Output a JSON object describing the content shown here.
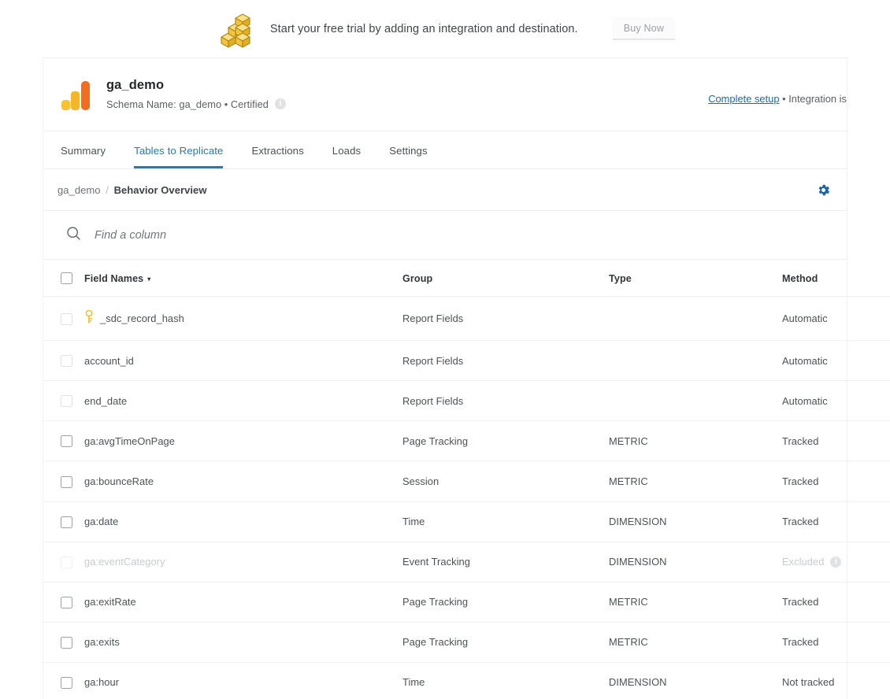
{
  "banner": {
    "icon": "stacked-blocks-icon",
    "text": "Start your free trial by adding an integration and destination.",
    "cta_label": "Buy Now"
  },
  "integration": {
    "logo": "google-analytics-logo",
    "name": "ga_demo",
    "subtitle": "Schema Name: ga_demo • Certified",
    "subtitle_info_icon": "info-icon",
    "status_link_label": "Complete setup",
    "status_text": "• Integration is",
    "link_color": "#176cb0"
  },
  "tabs": [
    {
      "label": "Summary",
      "active": false
    },
    {
      "label": "Tables to Replicate",
      "active": true
    },
    {
      "label": "Extractions",
      "active": false
    },
    {
      "label": "Loads",
      "active": false
    },
    {
      "label": "Settings",
      "active": false
    }
  ],
  "tab_active_color": "#2079c4",
  "breadcrumb": {
    "root": "ga_demo",
    "separator": "/",
    "current": "Behavior Overview",
    "settings_icon": "gear-icon",
    "settings_icon_color": "#1c63a8"
  },
  "search": {
    "icon": "search-icon",
    "placeholder": "Find a column",
    "value": ""
  },
  "table": {
    "columns": [
      {
        "key": "name",
        "label": "Field Names",
        "sorted": true,
        "sort_caret": "▾"
      },
      {
        "key": "group",
        "label": "Group"
      },
      {
        "key": "type",
        "label": "Type"
      },
      {
        "key": "method",
        "label": "Method"
      }
    ],
    "header_checkbox": "select-all-checkbox",
    "rows": [
      {
        "name": "_sdc_record_hash",
        "group": "Report Fields",
        "type": "",
        "method": "Automatic",
        "checkbox": "muted",
        "key_icon": true,
        "disabled": false,
        "method_info": false
      },
      {
        "name": "account_id",
        "group": "Report Fields",
        "type": "",
        "method": "Automatic",
        "checkbox": "muted",
        "key_icon": false,
        "disabled": false,
        "method_info": false
      },
      {
        "name": "end_date",
        "group": "Report Fields",
        "type": "",
        "method": "Automatic",
        "checkbox": "muted",
        "key_icon": false,
        "disabled": false,
        "method_info": false
      },
      {
        "name": "ga:avgTimeOnPage",
        "group": "Page Tracking",
        "type": "METRIC",
        "method": "Tracked",
        "checkbox": "normal",
        "key_icon": false,
        "disabled": false,
        "method_info": false
      },
      {
        "name": "ga:bounceRate",
        "group": "Session",
        "type": "METRIC",
        "method": "Tracked",
        "checkbox": "normal",
        "key_icon": false,
        "disabled": false,
        "method_info": false
      },
      {
        "name": "ga:date",
        "group": "Time",
        "type": "DIMENSION",
        "method": "Tracked",
        "checkbox": "normal",
        "key_icon": false,
        "disabled": false,
        "method_info": false
      },
      {
        "name": "ga:eventCategory",
        "group": "Event Tracking",
        "type": "DIMENSION",
        "method": "Excluded",
        "checkbox": "ghost",
        "key_icon": false,
        "disabled": true,
        "method_info": true
      },
      {
        "name": "ga:exitRate",
        "group": "Page Tracking",
        "type": "METRIC",
        "method": "Tracked",
        "checkbox": "normal",
        "key_icon": false,
        "disabled": false,
        "method_info": false
      },
      {
        "name": "ga:exits",
        "group": "Page Tracking",
        "type": "METRIC",
        "method": "Tracked",
        "checkbox": "normal",
        "key_icon": false,
        "disabled": false,
        "method_info": false
      },
      {
        "name": "ga:hour",
        "group": "Time",
        "type": "DIMENSION",
        "method": "Not tracked",
        "checkbox": "normal",
        "key_icon": false,
        "disabled": false,
        "method_info": false
      }
    ]
  }
}
